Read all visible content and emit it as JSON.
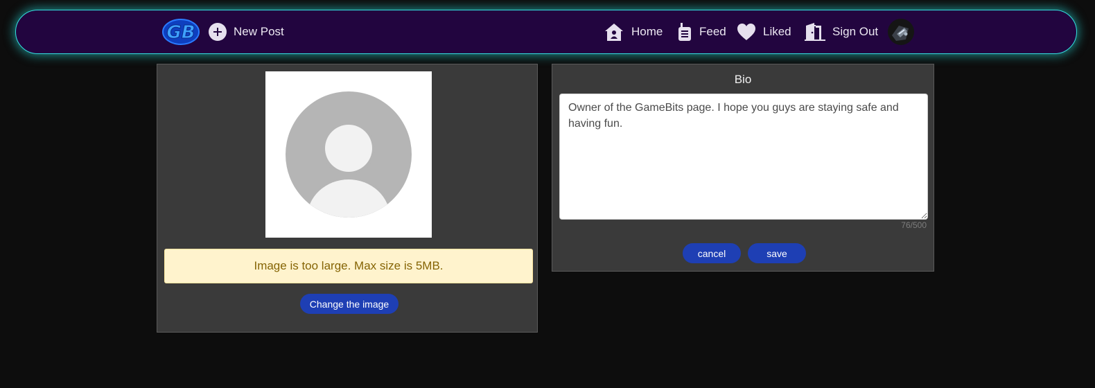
{
  "nav": {
    "logo_text": "GB",
    "new_post_label": "New Post",
    "items": [
      {
        "label": "Home",
        "icon": "home-icon"
      },
      {
        "label": "Feed",
        "icon": "walkie-talkie-icon"
      },
      {
        "label": "Liked",
        "icon": "heart-icon"
      },
      {
        "label": "Sign Out",
        "icon": "door-exit-icon"
      }
    ]
  },
  "profile": {
    "image_error": "Image is too large. Max size is 5MB.",
    "change_image_label": "Change the image"
  },
  "bio": {
    "title": "Bio",
    "text": "Owner of the GameBits page. I hope you guys are staying safe and having fun.",
    "char_count": "76/500",
    "cancel_label": "cancel",
    "save_label": "save"
  },
  "colors": {
    "navbar_bg": "#22053f",
    "navbar_glow": "#34e0e0",
    "button_blue": "#1e3fb4",
    "panel_bg": "#3a3a3a",
    "alert_bg": "#fff3cd",
    "alert_text": "#856404"
  }
}
